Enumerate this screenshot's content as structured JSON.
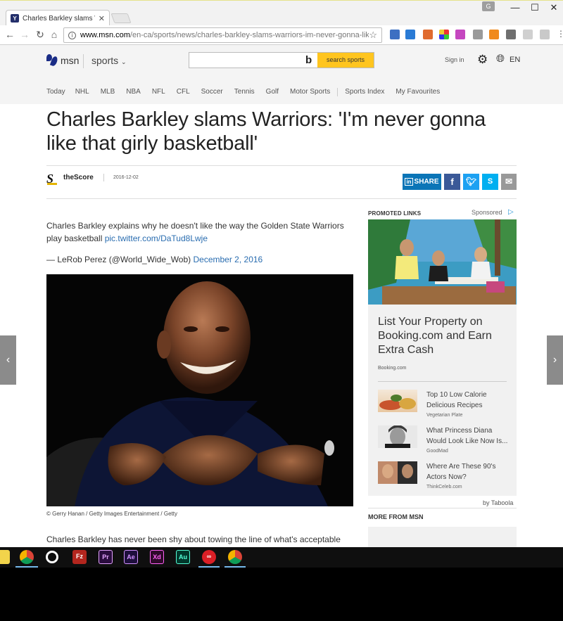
{
  "browser": {
    "tab_title": "Charles Barkley slams Wa",
    "profile_initial": "G",
    "url_host": "www.msn.com",
    "url_path": "/en-ca/sports/news/charles-barkley-slams-warriors-im-never-gonna-like-t"
  },
  "header": {
    "brand": "msn",
    "section": "sports",
    "search_button": "search sports",
    "sign_in": "Sign in",
    "language": "EN"
  },
  "subnav": [
    "Today",
    "NHL",
    "MLB",
    "NBA",
    "NFL",
    "CFL",
    "Soccer",
    "Tennis",
    "Golf",
    "Motor Sports",
    "Sports Index",
    "My Favourites"
  ],
  "article": {
    "title": "Charles Barkley slams Warriors: 'I'm never gonna like that girly basketball'",
    "source": "theScore",
    "date": "2016-12-02",
    "share_label": "SHARE",
    "tweet_text": "Charles Barkley explains why he doesn't like the way the Golden State Warriors play basketball ",
    "tweet_link": "pic.twitter.com/DaTud8Lwje",
    "tweet_author": "— LeRob Perez (@World_Wide_Wob) ",
    "tweet_date": "December 2, 2016",
    "photo_caption": "© Gerry Hanan / Getty Images Entertainment / Getty",
    "body_start": "Charles Barkley has never been shy about towing the line of what's acceptable basketball banter, and the Hall of Famer was back to his old tricks Thursday night on TNT."
  },
  "sidebar": {
    "promoted": "PROMOTED LINKS",
    "sponsored": "Sponsored",
    "ad_title": "List Your Property on Booking.com and Earn Extra Cash",
    "ad_source": "Booking.com",
    "items": [
      {
        "title": "Top 10 Low Calorie Delicious Recipes",
        "source": "Vegetarian Plate"
      },
      {
        "title": "What Princess Diana Would Look Like Now Is...",
        "source": "GoodMad"
      },
      {
        "title": "Where Are These 90's Actors Now?",
        "source": "ThinkCeleb.com"
      }
    ],
    "by_taboola": "by Taboola",
    "more_from": "MORE FROM MSN"
  },
  "colors": {
    "search_button": "#ffc51f",
    "link": "#2a6db0",
    "linkedin": "#0b75b7",
    "facebook": "#3b5998",
    "twitter": "#1da1f2",
    "skype": "#00aff0",
    "mail": "#999999"
  }
}
